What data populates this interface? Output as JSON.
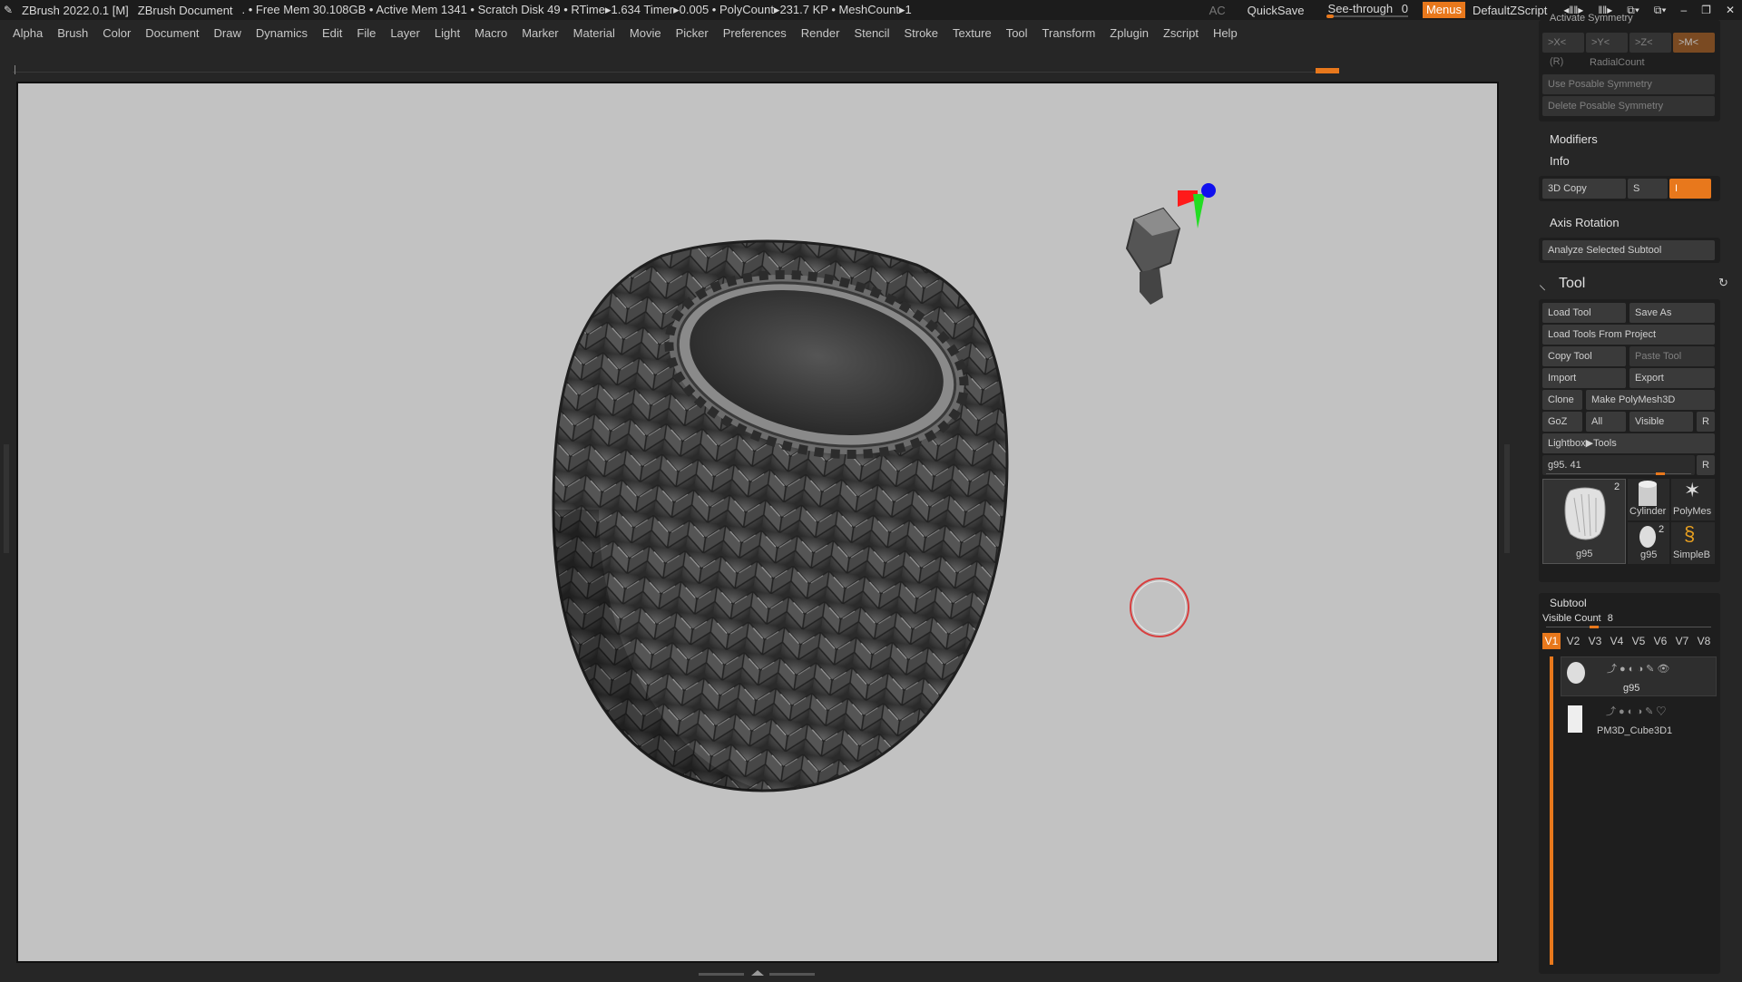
{
  "titlebar": {
    "app": "ZBrush 2022.0.1 [M]",
    "document": "ZBrush Document",
    "stats": ". • Free Mem 30.108GB • Active Mem 1341 • Scratch Disk 49 • RTime▸1.634 Timer▸0.005 • PolyCount▸231.7 KP • MeshCount▸1",
    "ac": "AC",
    "quicksave": "QuickSave",
    "see_through_label": "See-through",
    "see_through_value": "0",
    "menus": "Menus",
    "script": "DefaultZScript"
  },
  "menu": [
    "Alpha",
    "Brush",
    "Color",
    "Document",
    "Draw",
    "Dynamics",
    "Edit",
    "File",
    "Layer",
    "Light",
    "Macro",
    "Marker",
    "Material",
    "Movie",
    "Picker",
    "Preferences",
    "Render",
    "Stencil",
    "Stroke",
    "Texture",
    "Tool",
    "Transform",
    "Zplugin",
    "Zscript",
    "Help"
  ],
  "panel": {
    "activate_symmetry": "Activate Symmetry",
    "sym_x": ">X<",
    "sym_y": ">Y<",
    "sym_z": ">Z<",
    "sym_m": ">M<",
    "sym_r": "(R)",
    "radial_count": "RadialCount",
    "use_posable": "Use Posable Symmetry",
    "delete_posable": "Delete Posable Symmetry",
    "modifiers": "Modifiers",
    "info": "Info",
    "copy3d": "3D Copy",
    "s": "S",
    "i": "I",
    "axis_rotation": "Axis Rotation",
    "analyze": "Analyze Selected Subtool",
    "tool_title": "Tool",
    "load_tool": "Load Tool",
    "save_as": "Save As",
    "load_from_project": "Load Tools From Project",
    "copy_tool": "Copy Tool",
    "paste_tool": "Paste Tool",
    "import": "Import",
    "export": "Export",
    "clone": "Clone",
    "make_polymesh": "Make PolyMesh3D",
    "goz": "GoZ",
    "all": "All",
    "visible": "Visible",
    "r": "R",
    "lightbox_tools": "Lightbox▶Tools",
    "current_tool": "g95. 41",
    "thumbs": {
      "main_name": "g95",
      "main_count": "2",
      "cylinder": "Cylinder",
      "polymesh": "PolyMes",
      "g95_small": "g95",
      "g95_small_count": "2",
      "simpleb": "SimpleB"
    },
    "subtool_title": "Subtool",
    "visible_count_label": "Visible Count",
    "visible_count_value": "8",
    "vtabs": [
      "V1",
      "V2",
      "V3",
      "V4",
      "V5",
      "V6",
      "V7",
      "V8"
    ],
    "subtools": [
      {
        "name": "g95"
      },
      {
        "name": "PM3D_Cube3D1"
      }
    ]
  },
  "colors": {
    "accent": "#e8781c",
    "canvas": "#c2c2c2",
    "panel": "#262626"
  },
  "icons": [
    "brush-icon",
    "refresh-icon",
    "eye-icon",
    "paint-icon",
    "gizmo-icon",
    "minimize-icon",
    "maximize-icon",
    "close-icon"
  ]
}
